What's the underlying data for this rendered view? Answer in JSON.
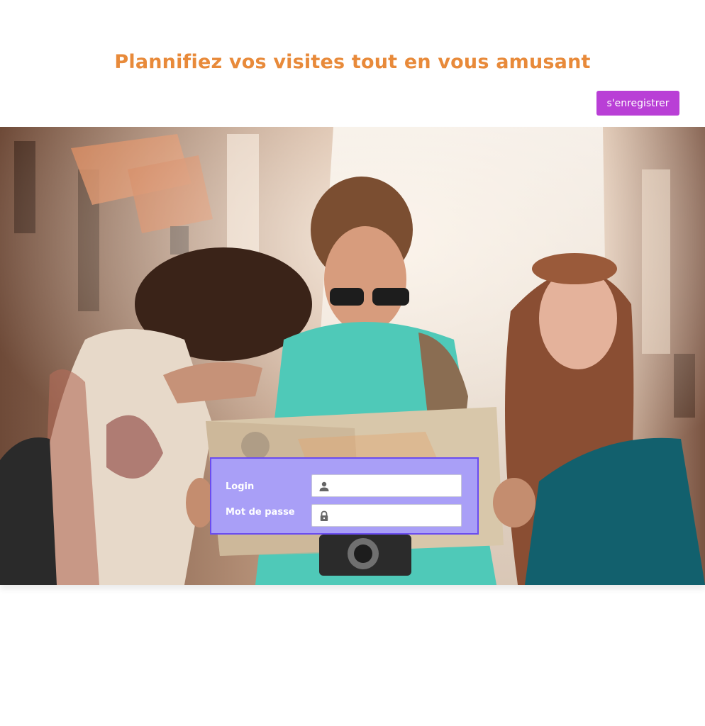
{
  "header": {
    "title": "Plannifiez vos visites tout en vous amusant",
    "register_label": "s'enregistrer"
  },
  "login": {
    "login_label": "Login",
    "password_label": "Mot de passe",
    "login_value": "",
    "password_value": ""
  },
  "icons": {
    "user": "user-icon",
    "lock": "lock-icon"
  },
  "colors": {
    "title": "#e88a3a",
    "register_button": "#b93fd6",
    "login_panel_bg": "#a99ff7",
    "login_panel_border": "#6a4cf0"
  }
}
